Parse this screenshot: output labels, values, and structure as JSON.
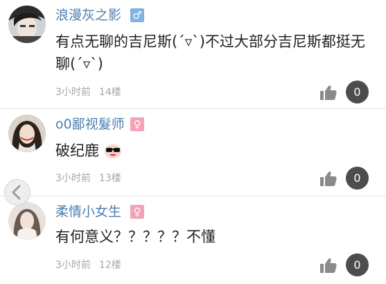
{
  "comments": [
    {
      "username": "浪漫灰之影",
      "gender": "male",
      "gender_symbol": "♂",
      "text": "有点无聊的吉尼斯(´▿`)不过大部分吉尼斯都挺无聊(´▿`)",
      "time": "3小时前",
      "floor": "14楼",
      "likes": "0"
    },
    {
      "username": "o0鄙视髮师",
      "gender": "female",
      "gender_symbol": "♀",
      "text": "破纪鹿",
      "time": "3小时前",
      "floor": "13楼",
      "likes": "0"
    },
    {
      "username": "柔情小女生",
      "gender": "female",
      "gender_symbol": "♀",
      "text": "有何意义？？？？？不懂",
      "time": "3小时前",
      "floor": "12楼",
      "likes": "0"
    }
  ],
  "icons": {
    "like": "thumbs-up-icon",
    "back": "chevron-left-icon",
    "emoji": "sunglasses-emoji-icon"
  },
  "colors": {
    "username": "#4a7fb2",
    "male_badge": "#7eb3e2",
    "female_badge": "#f4a3b6",
    "count_badge": "#4d4d4d"
  }
}
